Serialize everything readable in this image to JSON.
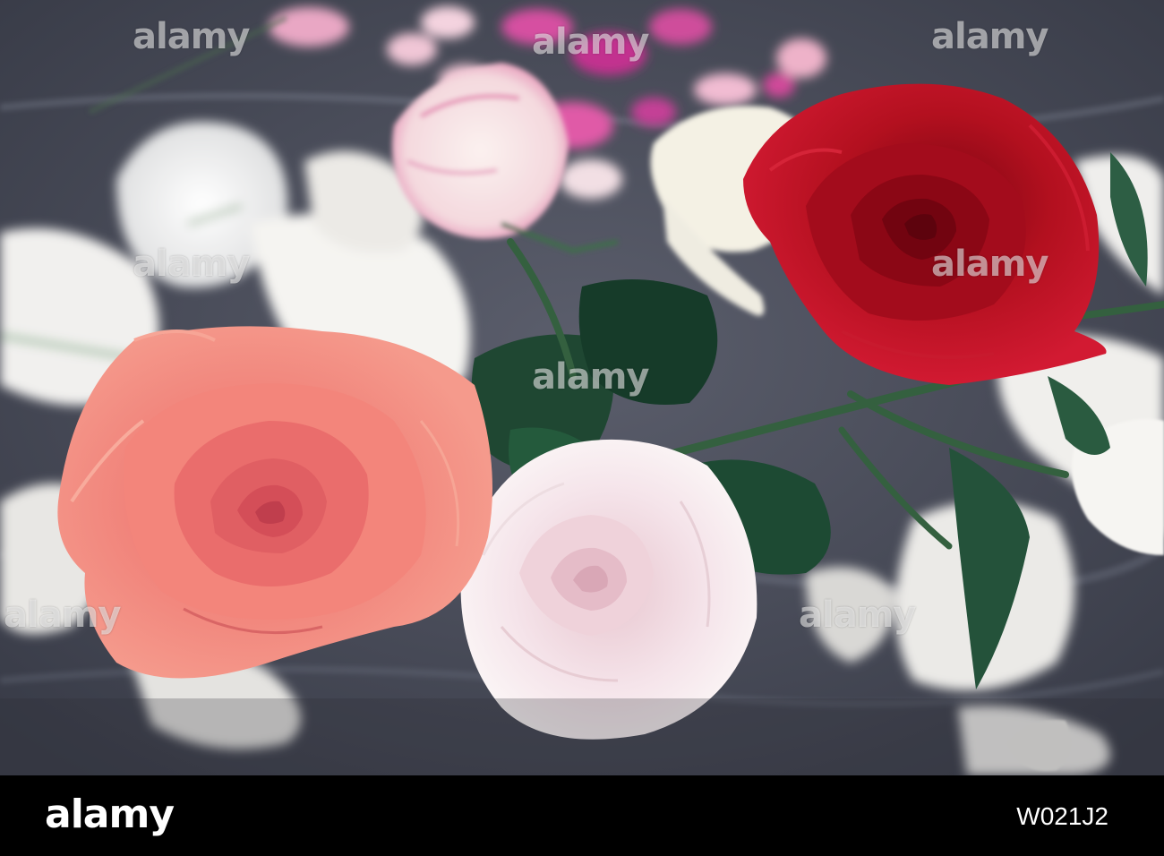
{
  "watermarks": {
    "w1": "alamy",
    "w2": "alamy",
    "w3": "alamy",
    "w4": "alamy",
    "w5": "alamy",
    "w6": "alamy",
    "w7": "alamy",
    "w8": "alamy"
  },
  "footer": {
    "logo": "alamy",
    "image_id": "W021J2"
  },
  "colors": {
    "background": "#4a4e5c",
    "coral_rose": "#f07a74",
    "red_rose": "#b5101e",
    "pale_pink_rose": "#f4e6ea",
    "lily_white": "#f3f1ee",
    "leaf_green": "#1e4a32",
    "petal_magenta": "#d04a9a"
  }
}
